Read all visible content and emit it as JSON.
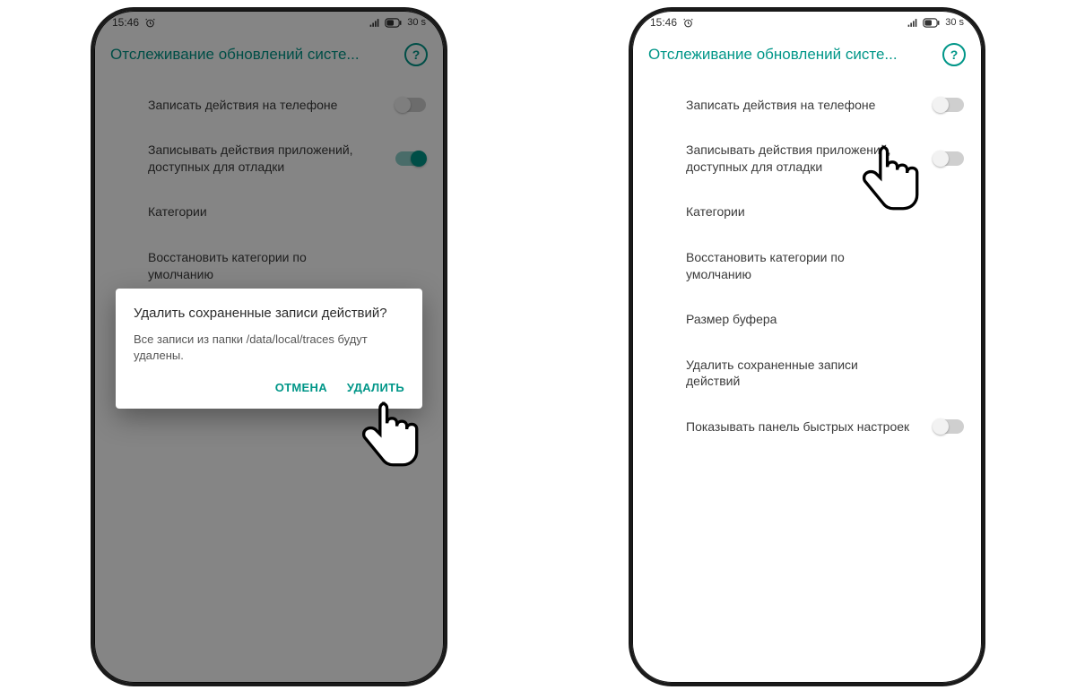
{
  "status": {
    "time": "15:46",
    "battery_suffix": "30 s"
  },
  "appbar": {
    "title": "Отслеживание обновлений систе...",
    "help": "?"
  },
  "rows": {
    "record_phone": "Записать действия на телефоне",
    "record_debug_apps": "Записывать действия приложений, доступных для отладки",
    "categories": "Категории",
    "restore_categories": "Восстановить категории по умолчанию",
    "buffer_size": "Размер буфера",
    "delete_saved": "Удалить сохраненные записи действий",
    "show_qs_panel": "Показывать панель быстрых настроек"
  },
  "dialog": {
    "title": "Удалить сохраненные записи действий?",
    "body": "Все записи из папки /data/local/traces будут удалены.",
    "cancel": "ОТМЕНА",
    "confirm": "УДАЛИТЬ"
  }
}
